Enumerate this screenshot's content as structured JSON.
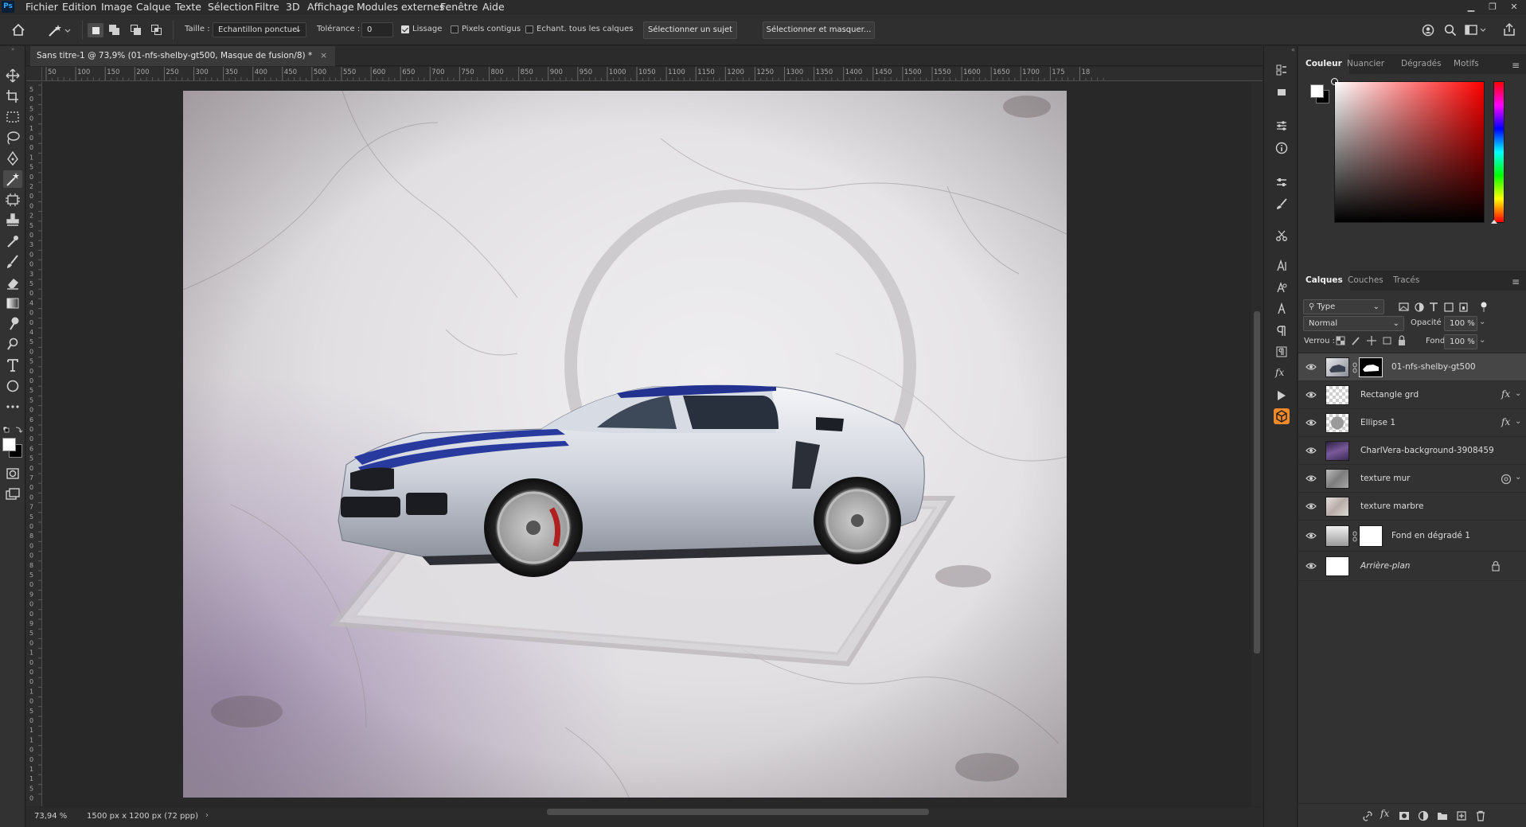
{
  "menubar": {
    "items": [
      "Fichier",
      "Edition",
      "Image",
      "Calque",
      "Texte",
      "Sélection",
      "Filtre",
      "3D",
      "Affichage",
      "Modules externes",
      "Fenêtre",
      "Aide"
    ]
  },
  "options": {
    "size_label": "Taille :",
    "size_value": "Echantillon ponctuel",
    "tolerance_label": "Tolérance :",
    "tolerance_value": "0",
    "antialias_label": "Lissage",
    "contiguous_label": "Pixels contigus",
    "sample_all_label": "Echant. tous les calques",
    "select_subject": "Sélectionner un sujet",
    "select_mask": "Sélectionner et masquer..."
  },
  "document": {
    "tab_title": "Sans titre-1 @ 73,9% (01-nfs-shelby-gt500, Masque de fusion/8) *",
    "ruler_h": [
      "50",
      "100",
      "150",
      "200",
      "250",
      "300",
      "350",
      "400",
      "450",
      "500",
      "550",
      "600",
      "650",
      "700",
      "750",
      "800",
      "850",
      "900",
      "950",
      "1000",
      "1050",
      "1100",
      "1150",
      "1200",
      "1250",
      "1300",
      "1350",
      "1400",
      "1450",
      "1500",
      "1550",
      "1600",
      "1650",
      "1700",
      "175",
      "18"
    ],
    "ruler_v": [
      "5",
      "0",
      "5",
      "0",
      "1",
      "0",
      "0",
      "1",
      "5",
      "0",
      "2",
      "0",
      "0",
      "2",
      "5",
      "0",
      "3",
      "0",
      "0",
      "3",
      "5",
      "0",
      "4",
      "0",
      "0",
      "4",
      "5",
      "0",
      "5",
      "0",
      "0",
      "5",
      "5",
      "0",
      "6",
      "0",
      "0",
      "6",
      "5",
      "0",
      "7",
      "0",
      "0",
      "7",
      "5",
      "0",
      "8",
      "0",
      "0",
      "8",
      "5",
      "0",
      "9",
      "0",
      "0",
      "9",
      "5",
      "0",
      "1",
      "0",
      "0",
      "0",
      "1",
      "0",
      "5",
      "0",
      "1",
      "1",
      "0",
      "0",
      "1",
      "1",
      "5",
      "0"
    ]
  },
  "status": {
    "zoom": "73,94 %",
    "doc_info": "1500 px x 1200 px (72 ppp)"
  },
  "color_panel": {
    "tabs": [
      "Couleur",
      "Nuancier",
      "Dégradés",
      "Motifs"
    ],
    "active": "Couleur"
  },
  "layers_panel": {
    "tabs": [
      "Calques",
      "Couches",
      "Tracés"
    ],
    "active": "Calques",
    "filter_value": "Type",
    "blend_mode": "Normal",
    "opacity_label": "Opacité :",
    "opacity_value": "100 %",
    "lock_label": "Verrou :",
    "fill_label": "Fond :",
    "fill_value": "100 %",
    "layers": [
      {
        "name": "01-nfs-shelby-gt500",
        "selected": true,
        "mask": true
      },
      {
        "name": "Rectangle grd",
        "fx": true
      },
      {
        "name": "Ellipse 1",
        "fx": true
      },
      {
        "name": "CharlVera-background-3908459"
      },
      {
        "name": "texture mur"
      },
      {
        "name": "texture marbre"
      },
      {
        "name": "Fond en dégradé 1",
        "mask": true
      },
      {
        "name": "Arrière-plan",
        "locked": true
      }
    ]
  }
}
